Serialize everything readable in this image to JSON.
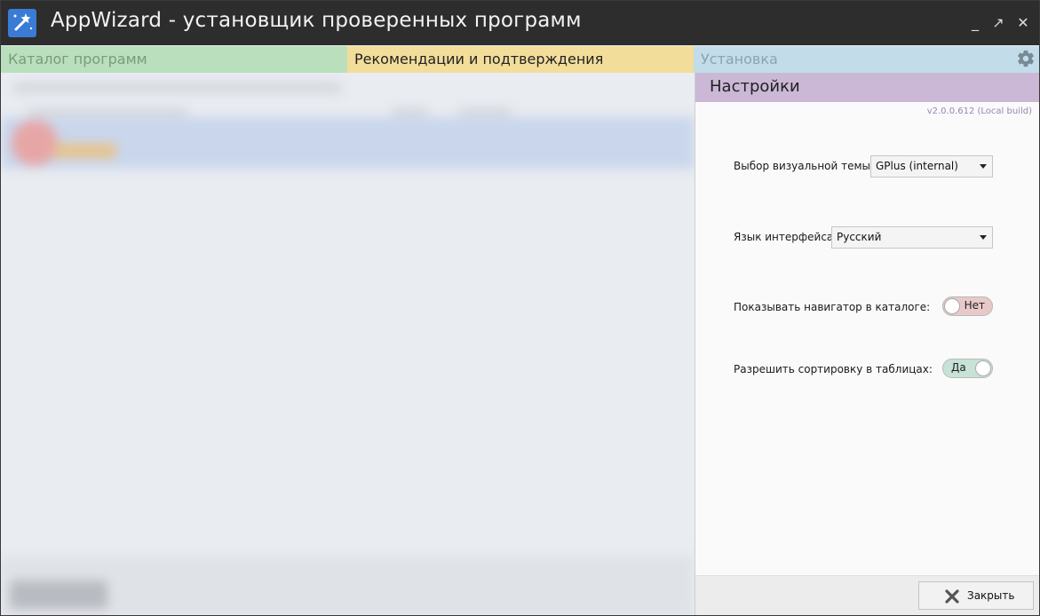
{
  "window": {
    "title": "AppWizard - установщик проверенных программ",
    "controls": {
      "minimize": "_",
      "maximize": "↗",
      "close": "✕"
    }
  },
  "tabs": [
    {
      "label": "Каталог программ"
    },
    {
      "label": "Рекомендации и подтверждения"
    },
    {
      "label": "Установка"
    }
  ],
  "settings": {
    "title": "Настройки",
    "version": "v2.0.0.612 (Local build)",
    "theme": {
      "label": "Выбор визуальной темы:",
      "value": "GPlus (internal)"
    },
    "language": {
      "label": "Язык интерфейса:",
      "value": "Русский"
    },
    "navigator": {
      "label": "Показывать навигатор в каталоге:",
      "value": "Нет",
      "enabled": false
    },
    "sorting": {
      "label": "Разрешить сортировку в таблицах:",
      "value": "Да",
      "enabled": true
    },
    "close_button": "Закрыть"
  },
  "colors": {
    "titlebar": "#2d2d2d",
    "tab_catalog": "#b9dfbc",
    "tab_recommend": "#f3dd9a",
    "tab_install": "#c2dcea",
    "settings_header": "#cbb8d6",
    "toggle_off": "#e8c9c9",
    "toggle_on": "#c7e2d6"
  },
  "icons": {
    "app": "app-wizard-icon",
    "settings": "gear-icon",
    "close": "close-x-icon"
  }
}
